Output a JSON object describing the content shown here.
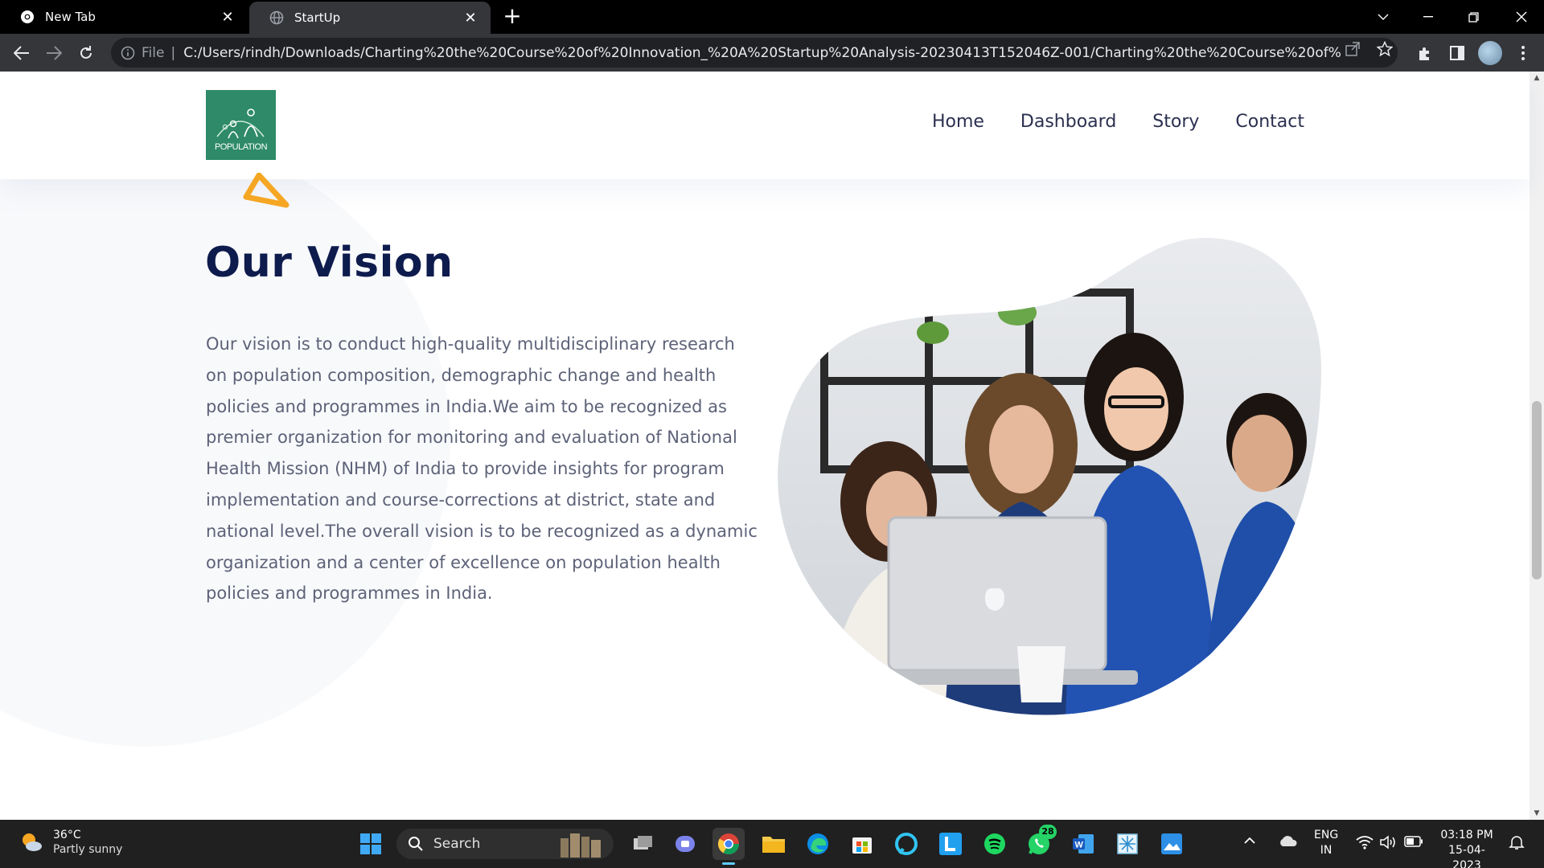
{
  "browser": {
    "tabs": [
      {
        "title": "New Tab",
        "icon": "chrome-icon",
        "active": false
      },
      {
        "title": "StartUp",
        "icon": "globe-icon",
        "active": true
      }
    ],
    "address": {
      "scheme_label": "File",
      "url": "C:/Users/rindh/Downloads/Charting%20the%20Course%20of%20Innovation_%20A%20Startup%20Analysis-20230413T152046Z-001/Charting%20the%20Course%20of%20Innovation_%..."
    }
  },
  "site": {
    "logo_text": "POPULATION",
    "nav": [
      "Home",
      "Dashboard",
      "Story",
      "Contact"
    ]
  },
  "vision": {
    "title": "Our Vision",
    "body": "Our vision is to conduct high-quality multidisciplinary research on population composition, demographic change and health policies and programmes in India.We aim to be recognized as premier organization for monitoring and evaluation of National Health Mission (NHM) of India to provide insights for program implementation and course-corrections at district, state and national level.The overall vision is to be recognized as a dynamic organization and a center of excellence on population health policies and programmes in India."
  },
  "taskbar": {
    "weather_temp": "36°C",
    "weather_cond": "Partly sunny",
    "search_label": "Search",
    "whatsapp_badge": "28",
    "lang_line1": "ENG",
    "lang_line2": "IN",
    "time": "03:18 PM",
    "date": "15-04-2023"
  },
  "colors": {
    "accent_dark": "#0e1b4d",
    "logo_green": "#2e8a68",
    "triangle_orange": "#f5a623",
    "body_text": "#5d6278"
  }
}
